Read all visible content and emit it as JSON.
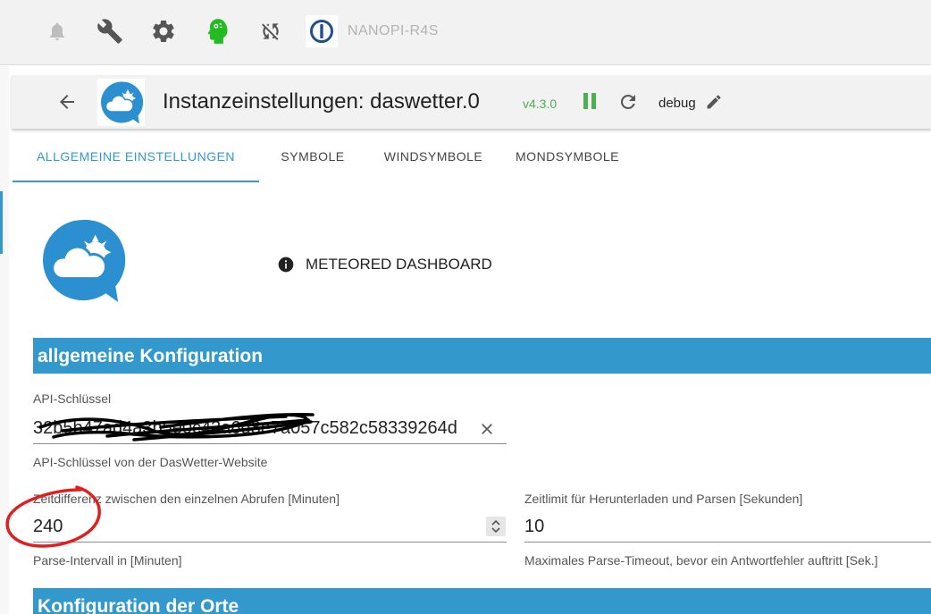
{
  "topbar": {
    "host_name": "NANOPI-R4S",
    "icons": [
      "bell-icon",
      "wrench-icon",
      "gear-icon",
      "expert-mode-icon",
      "sync-off-icon"
    ]
  },
  "instance": {
    "title": "Instanzeinstellungen: daswetter.0",
    "version": "v4.3.0",
    "log_level": "debug"
  },
  "tabs": [
    {
      "label": "ALLGEMEINE EINSTELLUNGEN",
      "active": true
    },
    {
      "label": "SYMBOLE",
      "active": false
    },
    {
      "label": "WINDSYMBOLE",
      "active": false
    },
    {
      "label": "MONDSYMBOLE",
      "active": false
    }
  ],
  "dashboard_link": "METEORED DASHBOARD",
  "sections": {
    "general": "allgemeine Konfiguration",
    "locations": "Konfiguration der Orte"
  },
  "fields": {
    "api_key": {
      "label": "API-Schlüssel",
      "value": "32b5b47ad4a3b5e0c43a6d8e7a057c582c58339264d",
      "help": "API-Schlüssel von der DasWetter-Website"
    },
    "interval": {
      "label": "Zeitdifferenz zwischen den einzelnen Abrufen [Minuten]",
      "value": "240",
      "help": "Parse-Intervall in [Minuten]"
    },
    "timeout": {
      "label": "Zeitlimit für Herunterladen und Parsen [Sekunden]",
      "value": "10",
      "help": "Maximales Parse-Timeout, bevor ein Antwortfehler auftritt [Sek.]"
    }
  },
  "colors": {
    "accent": "#3399cc",
    "version_green": "#4caf50",
    "expert_green": "#22bb22",
    "annotation_red": "#e02020"
  }
}
